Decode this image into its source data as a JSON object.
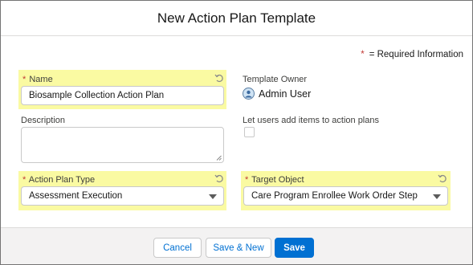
{
  "modal": {
    "title": "New Action Plan Template",
    "required_info_star": "*",
    "required_info_text": "= Required Information"
  },
  "fields": {
    "name": {
      "required_star": "*",
      "label": "Name",
      "value": "Biosample Collection Action Plan"
    },
    "template_owner": {
      "label": "Template Owner",
      "value": "Admin User"
    },
    "description": {
      "label": "Description",
      "value": ""
    },
    "let_users_add": {
      "label": "Let users add items to action plans",
      "checked": false
    },
    "action_plan_type": {
      "required_star": "*",
      "label": "Action Plan Type",
      "value": "Assessment Execution"
    },
    "target_object": {
      "required_star": "*",
      "label": "Target Object",
      "value": "Care Program Enrollee Work Order Step"
    }
  },
  "footer": {
    "cancel_label": "Cancel",
    "save_new_label": "Save & New",
    "save_label": "Save"
  },
  "colors": {
    "highlight": "#fafaa2",
    "brand": "#0070d2",
    "required": "#c23934"
  }
}
